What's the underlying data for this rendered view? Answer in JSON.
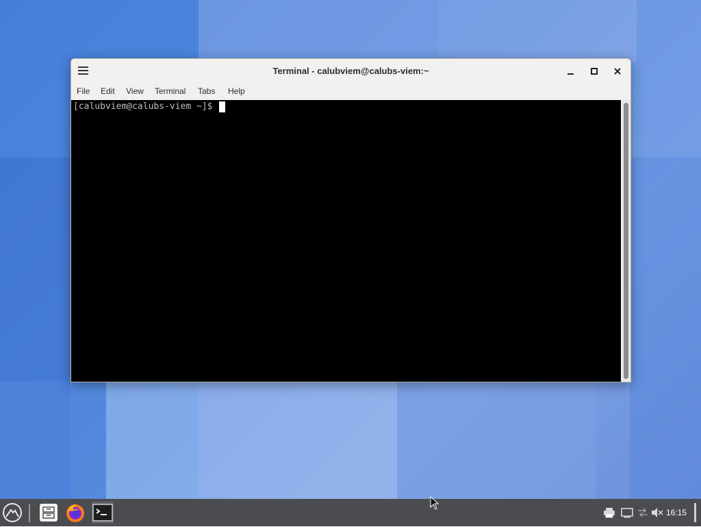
{
  "window": {
    "title": "Terminal - calubviem@calubs-viem:~",
    "menu": [
      "File",
      "Edit",
      "View",
      "Terminal",
      "Tabs",
      "Help"
    ],
    "controls": {
      "minimize": "minimize",
      "maximize": "maximize",
      "close": "close"
    }
  },
  "terminal": {
    "prompt": "[calubviem@calubs-viem ~]$ "
  },
  "taskbar": {
    "launchers": [
      "app-menu-icon",
      "file-manager-icon",
      "firefox-icon",
      "terminal-icon"
    ],
    "tray": [
      "printer-icon",
      "display-icon",
      "network-icon",
      "volume-muted-icon"
    ],
    "clock": "16:15"
  },
  "colors": {
    "desktop_accent": "#3f78d6",
    "terminal_bg": "#000000",
    "taskbar_bg": "#4a4c4f"
  }
}
